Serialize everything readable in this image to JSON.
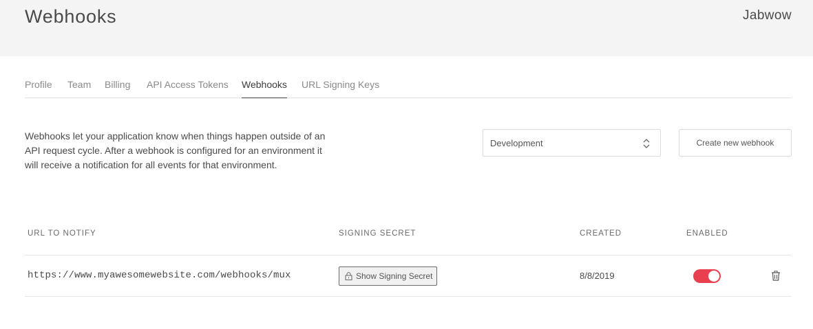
{
  "header": {
    "title": "Webhooks",
    "account_name": "Jabwow"
  },
  "tabs": [
    {
      "label": "Profile",
      "active": false
    },
    {
      "label": "Team",
      "active": false
    },
    {
      "label": "Billing",
      "active": false
    },
    {
      "label": "API Access Tokens",
      "active": false
    },
    {
      "label": "Webhooks",
      "active": true
    },
    {
      "label": "URL Signing Keys",
      "active": false
    }
  ],
  "intro": {
    "description": "Webhooks let your application know when things happen outside of an API request cycle. After a webhook is configured for an environment it will receive a notification for all events for that environment."
  },
  "environment_select": {
    "selected": "Development"
  },
  "actions": {
    "create_label": "Create new webhook"
  },
  "table": {
    "columns": {
      "url": "URL TO NOTIFY",
      "secret": "SIGNING SECRET",
      "created": "CREATED",
      "enabled": "ENABLED"
    },
    "rows": [
      {
        "url": "https://www.myawesomewebsite.com/webhooks/mux",
        "secret_button": "Show Signing Secret",
        "created": "8/8/2019",
        "enabled": true
      }
    ]
  },
  "colors": {
    "header_bg": "#f4f4f4",
    "toggle_on": "#e8404f"
  },
  "icons": {
    "select": "up-down-chevron-icon",
    "secret": "lock-icon",
    "delete": "trash-icon"
  }
}
